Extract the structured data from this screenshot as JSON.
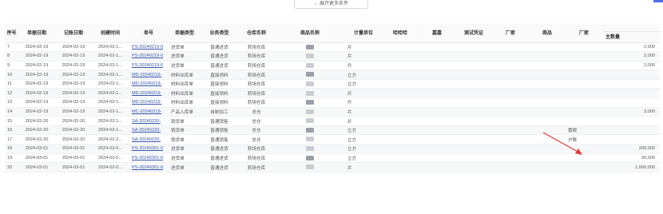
{
  "filter": {
    "expand_label": "展开更多条件"
  },
  "table": {
    "headers": [
      "序号",
      "单据日期",
      "记账日期",
      "创建时间",
      "单号",
      "单据类型",
      "业务类型",
      "仓库名称",
      "商品名称",
      "计量单位",
      "哈哈哈",
      "嘉嘉",
      "测试凭证",
      "厂家",
      "商品",
      "厂家",
      "主数量"
    ],
    "rows": [
      {
        "no": "7",
        "doc_date": "2024-02-19",
        "acct_date": "2024-02-19",
        "created": "2024-02-1...",
        "doc_no": "PS-20240219-0",
        "doc_type": "进货单",
        "biz_type": "普通进货",
        "warehouse": "莉场仓库",
        "unit": "片",
        "vendor2": "",
        "qty": "2,000"
      },
      {
        "no": "8",
        "doc_date": "2024-02-19",
        "acct_date": "2024-02-19",
        "created": "2024-02-1...",
        "doc_no": "PS-20240219-0",
        "doc_type": "进货单",
        "biz_type": "普通进货",
        "warehouse": "莉场仓库",
        "unit": "片",
        "vendor2": "",
        "qty": "2,000"
      },
      {
        "no": "9",
        "doc_date": "2024-02-19",
        "acct_date": "2024-02-19",
        "created": "2024-02-1...",
        "doc_no": "PS-20240219-0",
        "doc_type": "进货单",
        "biz_type": "普通进货",
        "warehouse": "莉场仓库",
        "unit": "升",
        "vendor2": "",
        "qty": "2,000"
      },
      {
        "no": "10",
        "doc_date": "2024-02-19",
        "acct_date": "2024-02-19",
        "created": "2024-02-1...",
        "doc_no": "MD-20240219-",
        "doc_type": "材料出库单",
        "biz_type": "直接领料",
        "warehouse": "莉场仓库",
        "unit": "立方",
        "vendor2": "",
        "qty": ""
      },
      {
        "no": "11",
        "doc_date": "2024-02-19",
        "acct_date": "2024-02-19",
        "created": "2024-02-1...",
        "doc_no": "MD-20240219-",
        "doc_type": "材料出库单",
        "biz_type": "直接领料",
        "warehouse": "莉场仓库",
        "unit": "立方",
        "vendor2": "",
        "qty": ""
      },
      {
        "no": "12",
        "doc_date": "2024-02-19",
        "acct_date": "2024-02-19",
        "created": "2024-02-1...",
        "doc_no": "MD-20240219-",
        "doc_type": "材料出库单",
        "biz_type": "直接领料",
        "warehouse": "莉场仓库",
        "unit": "片",
        "vendor2": "",
        "qty": ""
      },
      {
        "no": "13",
        "doc_date": "2024-02-19",
        "acct_date": "2024-02-19",
        "created": "2024-02-1...",
        "doc_no": "MD-20240219-",
        "doc_type": "材料出库单",
        "biz_type": "直接领料",
        "warehouse": "莉场仓库",
        "unit": "升",
        "vendor2": "",
        "qty": ""
      },
      {
        "no": "14",
        "doc_date": "2024-02-19",
        "acct_date": "2024-02-19",
        "created": "2024-02-1...",
        "doc_no": "MC-20240219-",
        "doc_type": "产品入库单",
        "biz_type": "自制加工",
        "warehouse": "总仓",
        "unit": "片",
        "vendor2": "",
        "qty": "3,000"
      },
      {
        "no": "15",
        "doc_date": "2024-02-20",
        "acct_date": "2024-02-20",
        "created": "2024-02-1...",
        "doc_no": "SA-20240220-",
        "doc_type": "销货单",
        "biz_type": "普通销售",
        "warehouse": "总仓",
        "unit": "片",
        "vendor2": "",
        "qty": ""
      },
      {
        "no": "16",
        "doc_date": "2024-02-20",
        "acct_date": "2024-02-20",
        "created": "2024-02-1...",
        "doc_no": "SA-20240220-",
        "doc_type": "销货单",
        "biz_type": "普通销售",
        "warehouse": "总仓",
        "unit": "立方",
        "vendor2": "蕾妮",
        "qty": ""
      },
      {
        "no": "17",
        "doc_date": "2024-02-20",
        "acct_date": "2024-02-20",
        "created": "2024-02-2...",
        "doc_no": "SA-20240220-",
        "doc_type": "销货单",
        "biz_type": "普通销售",
        "warehouse": "总仓",
        "unit": "立方",
        "vendor2": "沪联",
        "qty": ""
      },
      {
        "no": "18",
        "doc_date": "2024-03-01",
        "acct_date": "2024-03-01",
        "created": "2024-02-0...",
        "doc_no": "PS-20240301-0",
        "doc_type": "进货单",
        "biz_type": "普通进货",
        "warehouse": "莉场仓库",
        "unit": "立方",
        "vendor2": "",
        "qty": "200,000"
      },
      {
        "no": "19",
        "doc_date": "2024-03-01",
        "acct_date": "2024-03-01",
        "created": "2024-02-0...",
        "doc_no": "PS-20240301-0",
        "doc_type": "进货单",
        "biz_type": "普通进货",
        "warehouse": "莉场仓库",
        "unit": "立方",
        "vendor2": "",
        "qty": "30,000"
      },
      {
        "no": "20",
        "doc_date": "2024-03-01",
        "acct_date": "2024-03-01",
        "created": "2024-02-0...",
        "doc_no": "PS-20240301-0",
        "doc_type": "进货单",
        "biz_type": "普通进货",
        "warehouse": "莉场仓库",
        "unit": "片",
        "vendor2": "",
        "qty": "1,000,000"
      }
    ]
  },
  "colors": {
    "accent": "#4f6fe8",
    "link": "#3355aa",
    "annotation": "#e53935"
  }
}
